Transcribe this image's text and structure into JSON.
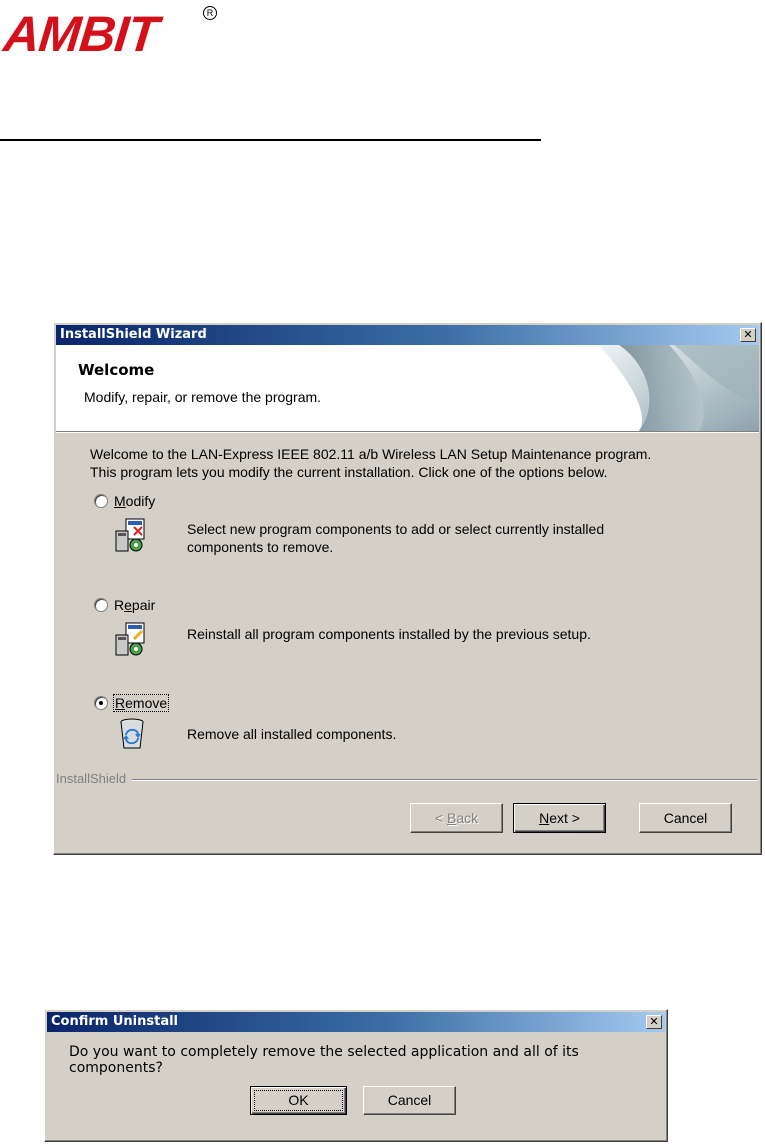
{
  "logo": {
    "text": "AMBIT",
    "registered": "R"
  },
  "wizard": {
    "title": "InstallShield Wizard",
    "close_glyph": "✕",
    "header": {
      "title": "Welcome",
      "subtitle": "Modify, repair, or remove the program."
    },
    "intro_line1": "Welcome to the LAN-Express IEEE 802.11 a/b Wireless LAN Setup Maintenance program.",
    "intro_line2": "This program lets you modify the current installation. Click one of the options below.",
    "options": [
      {
        "label": "Modify",
        "mnemonic": "M",
        "rest": "odify",
        "description_line1": "Select new program components to add or select currently installed",
        "description_line2": "components to remove.",
        "checked": false,
        "icon": "modify-program-icon"
      },
      {
        "label": "Repair",
        "mnemonic": "e",
        "pre": "R",
        "rest": "pair",
        "description_line1": "Reinstall all program components installed by the previous setup.",
        "checked": false,
        "icon": "repair-program-icon"
      },
      {
        "label": "Remove",
        "mnemonic": "R",
        "rest": "emove",
        "description_line1": "Remove all installed components.",
        "checked": true,
        "icon": "recycle-bin-icon"
      }
    ],
    "brand": "InstallShield",
    "buttons": {
      "back_pre": "< ",
      "back_mnemonic": "B",
      "back_rest": "ack",
      "next_mnemonic": "N",
      "next_rest": "ext >",
      "cancel": "Cancel"
    }
  },
  "confirm": {
    "title": "Confirm Uninstall",
    "message": "Do you want to completely remove the selected application and all of its components?",
    "ok": "OK",
    "cancel": "Cancel"
  }
}
